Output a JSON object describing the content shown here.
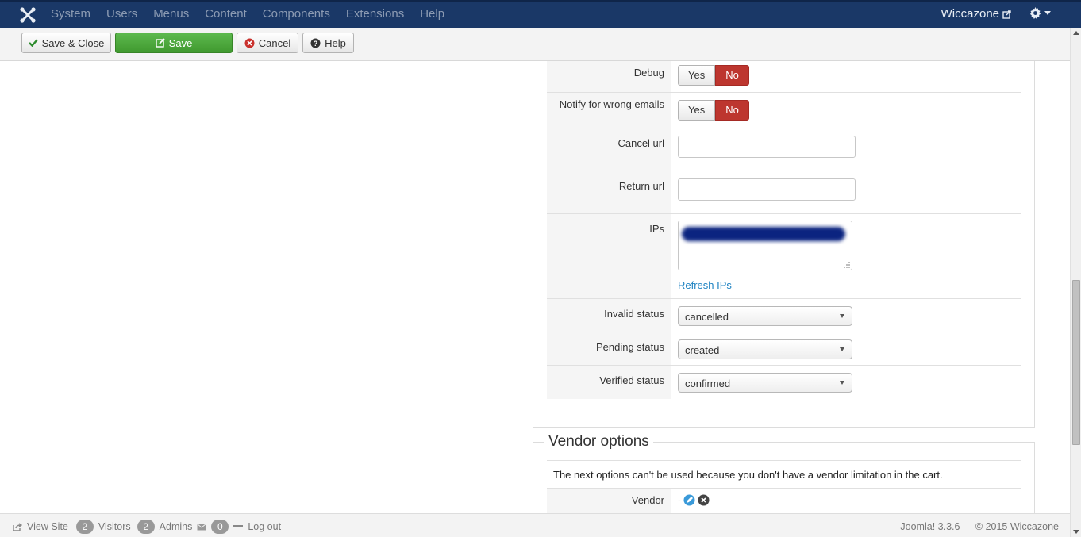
{
  "nav": {
    "menu": [
      "System",
      "Users",
      "Menus",
      "Content",
      "Components",
      "Extensions",
      "Help"
    ],
    "site_name": "Wiccazone"
  },
  "toolbar": {
    "save_close": "Save & Close",
    "save": "Save",
    "cancel": "Cancel",
    "help": "Help"
  },
  "form": {
    "debug": {
      "label": "Debug",
      "yes": "Yes",
      "no": "No",
      "selected": "No"
    },
    "notify": {
      "label": "Notify for wrong emails",
      "yes": "Yes",
      "no": "No",
      "selected": "No"
    },
    "cancel_url": {
      "label": "Cancel url",
      "value": ""
    },
    "return_url": {
      "label": "Return url",
      "value": ""
    },
    "ips": {
      "label": "IPs",
      "refresh": "Refresh IPs"
    },
    "invalid_status": {
      "label": "Invalid status",
      "value": "cancelled"
    },
    "pending_status": {
      "label": "Pending status",
      "value": "created"
    },
    "verified_status": {
      "label": "Verified status",
      "value": "confirmed"
    }
  },
  "vendor": {
    "legend": "Vendor options",
    "note": "The next options can't be used because you don't have a vendor limitation in the cart.",
    "label": "Vendor",
    "value": "-"
  },
  "status": {
    "view_site": "View Site",
    "visitors_count": "2",
    "visitors": "Visitors",
    "admins_count": "2",
    "admins": "Admins",
    "messages_count": "0",
    "logout": "Log out",
    "footer": "Joomla! 3.3.6 — © 2015 Wiccazone"
  },
  "colors": {
    "navbar": "#1a3867",
    "save_green": "#46a035",
    "no_red": "#bd362f",
    "link": "#1f83c2"
  }
}
